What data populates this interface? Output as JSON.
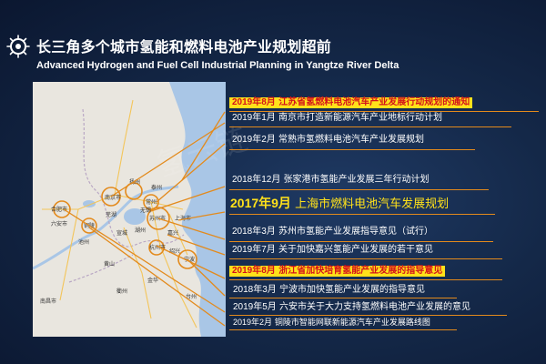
{
  "header": {
    "title": "长三角多个城市氢能和燃料电池产业规划超前",
    "subtitle": "Advanced Hydrogen and Fuel Cell Industrial Planning in Yangtze River Delta"
  },
  "map": {
    "cities": [
      "南京市",
      "扬州",
      "泰州",
      "常州",
      "苏州市",
      "无锡",
      "上海市",
      "嘉兴",
      "杭州市",
      "湖州",
      "宁波",
      "绍兴",
      "合肥市",
      "六安市",
      "铜陵",
      "芜湖",
      "池州",
      "宣城",
      "南昌市",
      "黄山",
      "衢州",
      "金华",
      "台州"
    ]
  },
  "watermark": "氢云链",
  "policies": [
    {
      "year": "2019年8月",
      "text": "江苏省氢燃料电池汽车产业发展行动规划的通知",
      "style": "highlight"
    },
    {
      "year": "2019年1月",
      "text": "南京市打造新能源汽车产业地标行动计划",
      "style": "normal"
    },
    {
      "year": "2019年2月",
      "text": "常熟市氢燃料电池汽车产业发展规划",
      "style": "normal"
    },
    {
      "year": "2018年12月",
      "text": "张家港市氢能产业发展三年行动计划",
      "style": "normal"
    },
    {
      "year": "2017年9月",
      "text": "上海市燃料电池汽车发展规划",
      "style": "big"
    },
    {
      "year": "2018年3月",
      "text": "苏州市氢能产业发展指导意见（试行）",
      "style": "normal"
    },
    {
      "year": "2019年7月",
      "text": "关于加快嘉兴氢能产业发展的若干意见",
      "style": "normal"
    },
    {
      "year": "2019年8月",
      "text": "浙江省加快培育氢能产业发展的指导意见",
      "style": "highlight"
    },
    {
      "year": "2018年3月",
      "text": "宁波市加快氢能产业发展的指导意见",
      "style": "normal"
    },
    {
      "year": "2019年5月",
      "text": "六安市关于大力支持氢燃料电池产业发展的意见",
      "style": "normal"
    },
    {
      "year": "2019年2月",
      "text": "铜陵市智能网联新能源汽车产业发展路线图",
      "style": "small"
    }
  ],
  "colors": {
    "accent_orange": "#e38a1c",
    "highlight_bg": "#ffe11a",
    "highlight_text": "#d3121b",
    "background": "#142848"
  }
}
